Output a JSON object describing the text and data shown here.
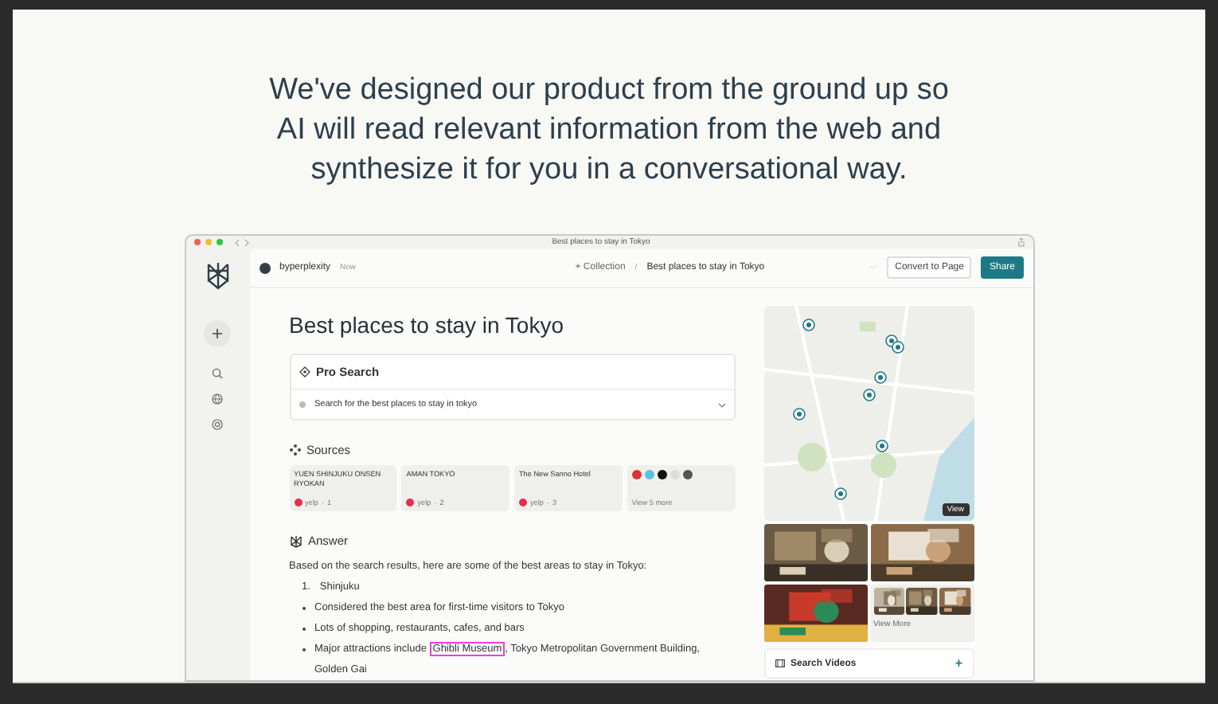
{
  "headline": "We've designed our product from the ground up so AI will read relevant information from the web and synthesize it for you in a conversational way.",
  "browser": {
    "title": "Best places to stay in Tokyo"
  },
  "header": {
    "user": "byperplexity",
    "time": "Now",
    "collection": "+ Collection",
    "separator": "/",
    "crumb": "Best places to stay in Tokyo",
    "more": "···",
    "convert": "Convert to Page",
    "share": "Share"
  },
  "page_title": "Best places to stay in Tokyo",
  "pro_search": {
    "title": "Pro Search",
    "step": "Search for the best places to stay in tokyo"
  },
  "sources": {
    "title": "Sources",
    "items": [
      {
        "title": "YUEN SHINJUKU ONSEN RYOKAN",
        "site": "yelp",
        "index": "1"
      },
      {
        "title": "AMAN TOKYO",
        "site": "yelp",
        "index": "2"
      },
      {
        "title": "The New Sanno Hotel",
        "site": "yelp",
        "index": "3"
      }
    ],
    "more": "View 5 more",
    "separator": "·"
  },
  "answer": {
    "title": "Answer",
    "intro": "Based on the search results, here are some of the best areas to stay in Tokyo:",
    "items": [
      {
        "kind": "numbered",
        "marker": "1.",
        "text": "Shinjuku"
      },
      {
        "kind": "bullet",
        "text": "Considered the best area for first-time visitors to Tokyo"
      },
      {
        "kind": "bullet",
        "text": "Lots of shopping, restaurants, cafes, and bars"
      },
      {
        "kind": "highlighted",
        "before": "Major attractions include ",
        "highlight": "Ghibli Museum",
        "after": ", Tokyo Metropolitan Government Building, Golden Gai"
      }
    ]
  },
  "media": {
    "map_button": "View",
    "view_more": "View More",
    "videos": "Search Videos",
    "videos_add": "+"
  }
}
